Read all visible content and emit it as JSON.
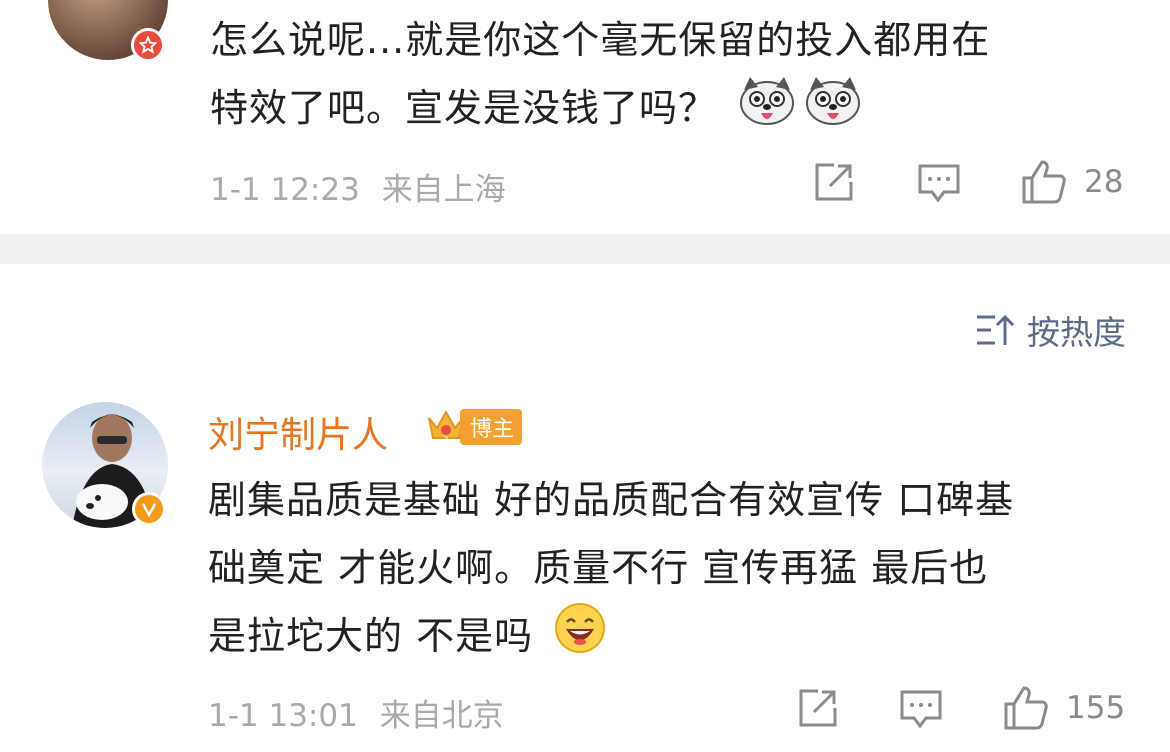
{
  "comment1": {
    "text_line1": "怎么说呢...就是你这个毫无保留的投入都用在",
    "text_line2": "特效了吧。宣发是没钱了吗？",
    "time": "1-1 12:23",
    "location": "来自上海",
    "likes": "28",
    "emoji": "husky-emoji",
    "badge_color": "#e94b3c"
  },
  "sort_label": "按热度",
  "comment2": {
    "username": "刘宁制片人",
    "tag": "博主",
    "text_line1": "剧集品质是基础 好的品质配合有效宣传 口碑基",
    "text_line2": "础奠定 才能火啊。质量不行 宣传再猛 最后也",
    "text_line3": "是拉坨大的 不是吗",
    "time": "1-1 13:01",
    "location": "来自北京",
    "likes": "155",
    "emoji": "laughing-emoji",
    "badge_color": "#f39a1b",
    "username_color": "#e8741e"
  }
}
